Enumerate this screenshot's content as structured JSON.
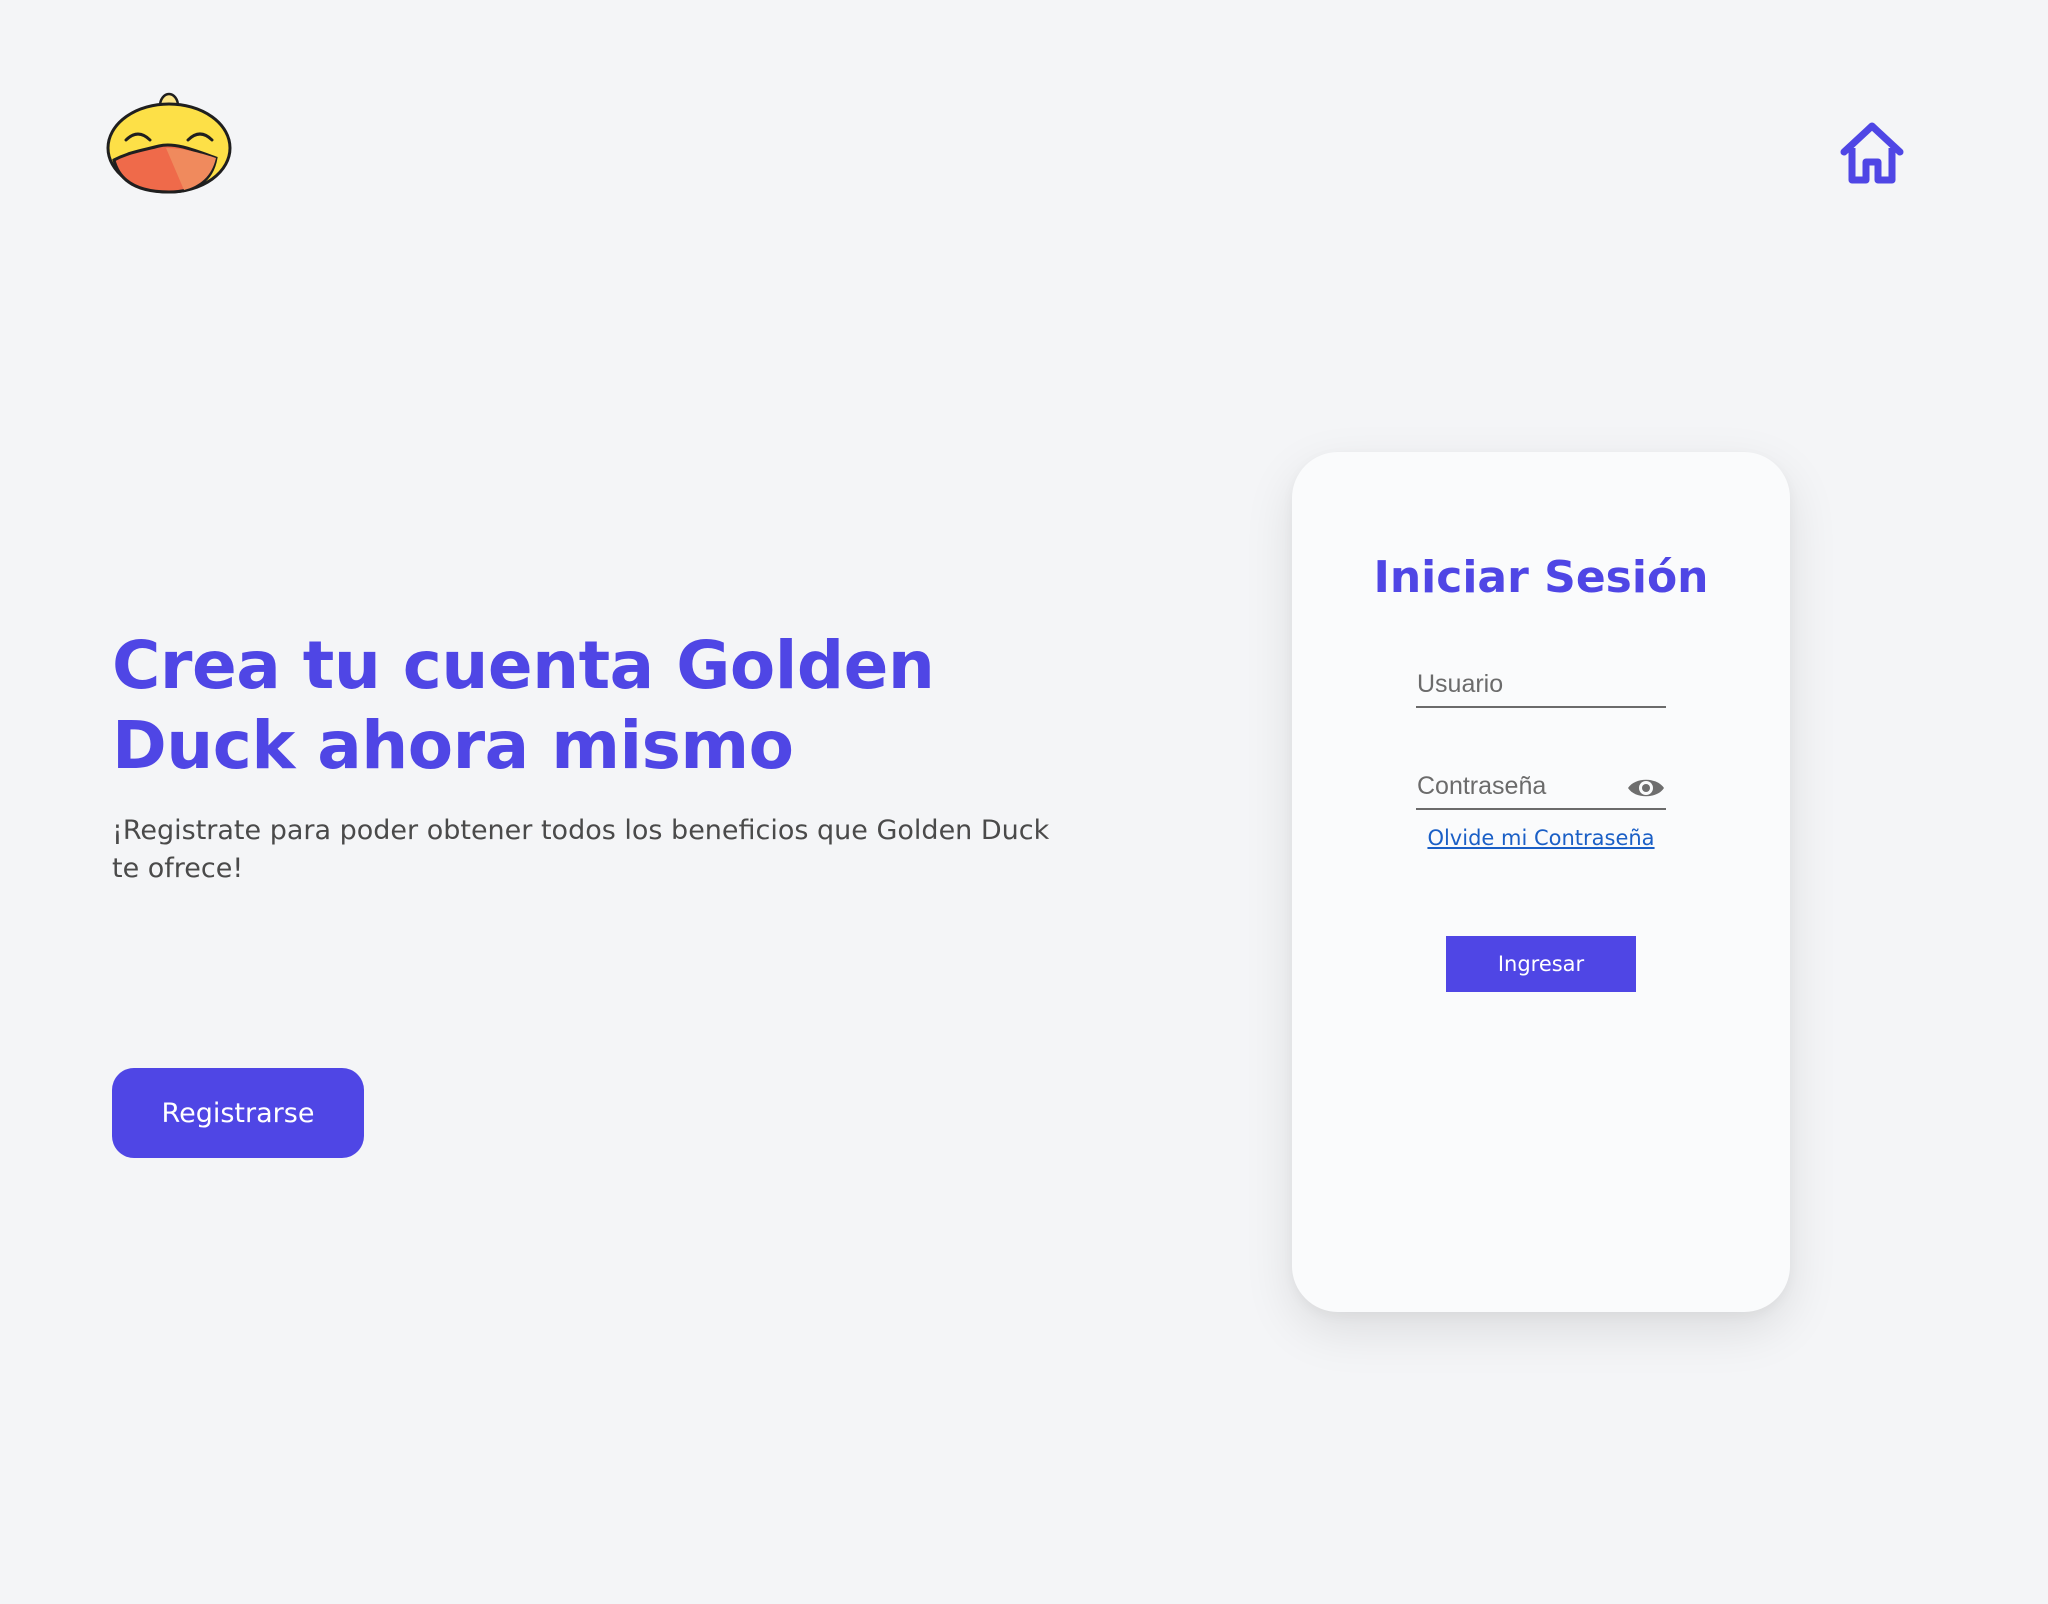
{
  "header": {
    "logo_icon": "duck-logo-icon",
    "home_icon": "home-icon"
  },
  "hero": {
    "title": "Crea tu cuenta Golden Duck ahora mismo",
    "subtitle": "¡Registrate para poder obtener todos los beneficios que Golden Duck te ofrece!",
    "register_label": "Registrarse"
  },
  "login": {
    "title": "Iniciar Sesión",
    "username_placeholder": "Usuario",
    "password_placeholder": "Contraseña",
    "forgot_label": "Olvide mi Contraseña",
    "submit_label": "Ingresar"
  },
  "colors": {
    "accent": "#4f46e5",
    "background": "#f4f5f7",
    "card": "#fafbfc",
    "link": "#1a5fc6"
  }
}
